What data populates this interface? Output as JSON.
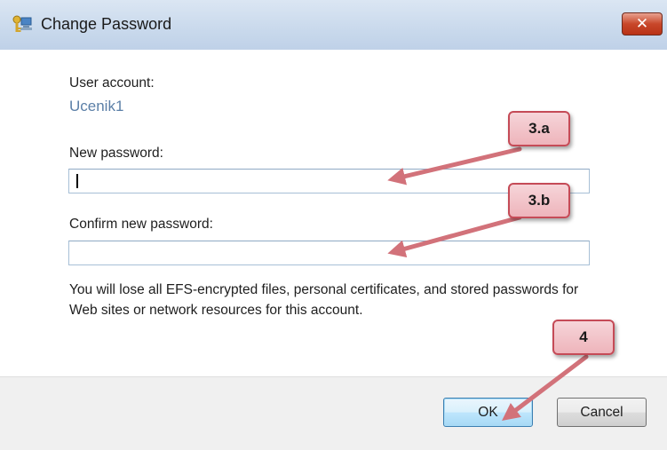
{
  "window": {
    "title": "Change Password",
    "close_symbol": "✕",
    "title_icon": "key-computer-icon"
  },
  "form": {
    "user_account_label": "User account:",
    "user_account_value": "Ucenik1",
    "new_password_label": "New password:",
    "new_password_value": "",
    "confirm_password_label": "Confirm new password:",
    "confirm_password_value": ""
  },
  "warning": "You will lose all EFS-encrypted files, personal certificates, and stored passwords for Web sites or network resources for this account.",
  "buttons": {
    "ok": "OK",
    "cancel": "Cancel"
  },
  "callouts": {
    "a": "3.a",
    "b": "3.b",
    "c": "4"
  },
  "colors": {
    "account_name": "#5b7fa7",
    "callout_fill": "#eeb4bb",
    "callout_border": "#c54b57",
    "arrow": "#d2727a"
  }
}
